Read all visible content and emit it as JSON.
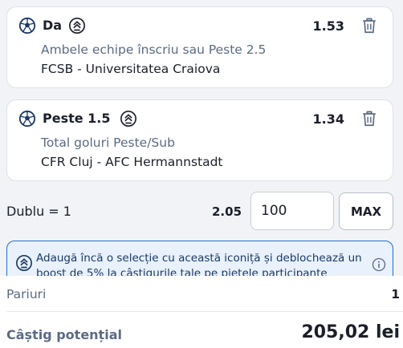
{
  "selections": [
    {
      "name": "Da",
      "odd": "1.53",
      "market": "Ambele echipe înscriu sau Peste 2.5",
      "match": "FCSB - Universitatea Craiova",
      "icons": [
        "football-icon",
        "boost-icon",
        "trash-icon"
      ]
    },
    {
      "name": "Peste 1.5",
      "odd": "1.34",
      "market": "Total goluri Peste/Sub",
      "match": "CFR Cluj - AFC Hermannstadt",
      "icons": [
        "football-icon",
        "boost-icon",
        "trash-icon"
      ]
    }
  ],
  "bet": {
    "label": "Dublu = 1",
    "odd": "2.05",
    "stake": "100",
    "max_label": "MAX"
  },
  "promo": {
    "text": "Adaugă încă o selecție cu această iconiță și deblochează un boost de 5% la câștigurile tale pe piețele participante",
    "icons": [
      "boost-icon",
      "info-icon"
    ]
  },
  "summary": {
    "pariuri_label": "Pariuri",
    "pariuri_value": "1",
    "castig_label": "Câștig potențial",
    "castig_value": "205,02 lei"
  },
  "colors": {
    "accent": "#1e6dd6",
    "promo_bg": "#e8f1fc",
    "text": "#1b1f2a",
    "muted": "#5a6b84"
  }
}
